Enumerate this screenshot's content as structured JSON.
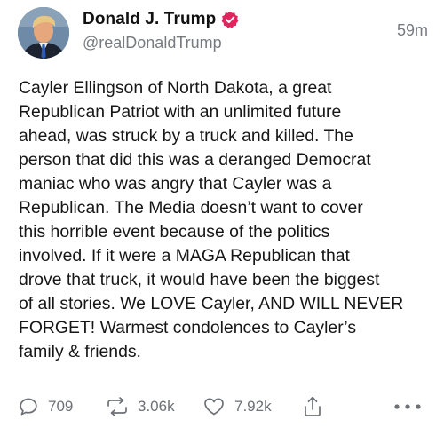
{
  "author": {
    "display_name": "Donald J. Trump",
    "handle": "@realDonaldTrump",
    "verified": true,
    "avatar_icon": "profile-avatar"
  },
  "post": {
    "timestamp": "59m",
    "text": "Cayler Ellingson of North Dakota, a great\nRepublican Patriot with an unlimited future\nahead, was struck by a truck and killed. The\nperson that did this was a deranged Democrat\nmaniac who was angry that Cayler was a\nRepublican. The Media doesn’t want to cover\nthis horrible event because of the politics\ninvolved. If it were a MAGA Republican that\ndrove that truck, it would have been the biggest\nof all stories. We LOVE Cayler, AND WILL NEVER\nFORGET! Warmest condolences to Cayler’s\nfamily & friends."
  },
  "actions": {
    "replies": "709",
    "reposts": "3.06k",
    "likes": "7.92k",
    "reply_icon": "reply-icon",
    "repost_icon": "repost-icon",
    "like_icon": "heart-icon",
    "share_icon": "share-icon",
    "more_icon": "more-icon"
  },
  "colors": {
    "verified_badge": "#e0245e",
    "muted_text": "#777b80",
    "icon": "#6d7176"
  }
}
